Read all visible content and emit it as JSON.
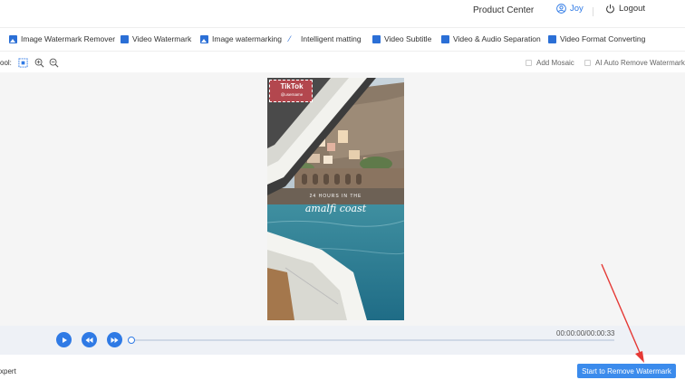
{
  "header": {
    "product_center": "Product Center",
    "user_name": "Joy",
    "logout_label": "Logout"
  },
  "tools": [
    {
      "label": "Image Watermark Remover",
      "icon": "image-icon"
    },
    {
      "label": "Video Watermark",
      "icon": "video-icon"
    },
    {
      "label": "Image watermarking",
      "icon": "image-icon"
    },
    {
      "label": "Intelligent matting",
      "icon": "magic-wand-icon"
    },
    {
      "label": "Video Subtitle",
      "icon": "video-icon"
    },
    {
      "label": "Video & Audio Separation",
      "icon": "video-icon"
    },
    {
      "label": "Video Format Converting",
      "icon": "file-video-icon"
    }
  ],
  "options": {
    "tool_label": "ool:",
    "add_mosaic": "Add Mosaic",
    "ai_auto_remove": "AI Auto Remove Watermark"
  },
  "video": {
    "watermark_text": "TikTok",
    "watermark_user": "@username",
    "caption_small": "24 HOURS IN THE",
    "caption_large": "amalfi coast"
  },
  "player": {
    "time": "00:00:00/00:00:33",
    "progress": 0
  },
  "footer": {
    "expert_label": "xpert",
    "start_button": "Start to Remove Watermark"
  },
  "colors": {
    "accent": "#2f7ae5",
    "button": "#3b8bec",
    "arrow": "#e53935"
  }
}
